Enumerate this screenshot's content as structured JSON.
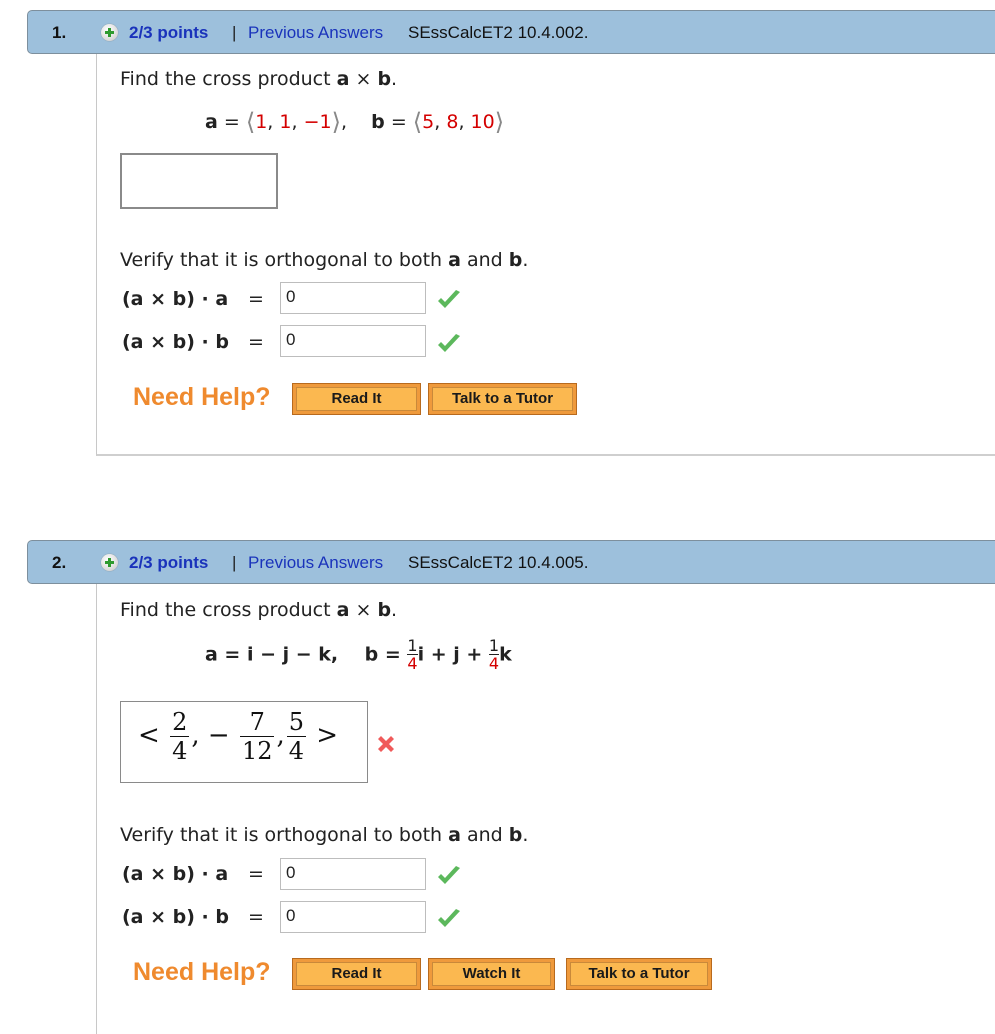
{
  "questions": [
    {
      "number": "1.",
      "points": "2/3 points",
      "separator": "|",
      "previous_answers": "Previous Answers",
      "code": "SEssCalcET2 10.4.002.",
      "prompt": {
        "prefix": "Find the cross product ",
        "a": "a",
        "times": " × ",
        "b": "b",
        "end": "."
      },
      "given": {
        "a_label": "a",
        "eq": " = ",
        "b_label": "b",
        "a_components": [
          "1",
          "1",
          "−1"
        ],
        "b_components": [
          "5",
          "8",
          "10"
        ]
      },
      "answer": {
        "value": "",
        "status": "empty"
      },
      "verify": {
        "prefix": "Verify that it is orthogonal to both ",
        "a": "a",
        "and": " and ",
        "b": "b",
        "end": "."
      },
      "dot_rows": [
        {
          "label_a": "(a × b) · ",
          "label_v": "a",
          "eq": "=",
          "value": "0",
          "status": "correct"
        },
        {
          "label_a": "(a × b) · ",
          "label_v": "b",
          "eq": "=",
          "value": "0",
          "status": "correct"
        }
      ],
      "help": {
        "label": "Need Help?",
        "buttons": [
          "Read It",
          "Talk to a Tutor"
        ]
      }
    },
    {
      "number": "2.",
      "points": "2/3 points",
      "separator": "|",
      "previous_answers": "Previous Answers",
      "code": "SEssCalcET2 10.4.005.",
      "prompt": {
        "prefix": "Find the cross product ",
        "a": "a",
        "times": " × ",
        "b": "b",
        "end": "."
      },
      "given": {
        "a_expr": "a = i − j − k,",
        "b_label": "b = ",
        "b_i_num": "1",
        "b_i_den": "4",
        "b_mid": "i + j + ",
        "b_k_num": "1",
        "b_k_den": "4",
        "b_end": "k"
      },
      "answer": {
        "open": "<",
        "close": ">",
        "minus": "−",
        "fractions": [
          {
            "num": "2",
            "den": "4"
          },
          {
            "num": "7",
            "den": "12"
          },
          {
            "num": "5",
            "den": "4"
          }
        ],
        "status": "incorrect"
      },
      "verify": {
        "prefix": "Verify that it is orthogonal to both ",
        "a": "a",
        "and": " and ",
        "b": "b",
        "end": "."
      },
      "dot_rows": [
        {
          "label_a": "(a × b) · ",
          "label_v": "a",
          "eq": "=",
          "value": "0",
          "status": "correct"
        },
        {
          "label_a": "(a × b) · ",
          "label_v": "b",
          "eq": "=",
          "value": "0",
          "status": "correct"
        }
      ],
      "help": {
        "label": "Need Help?",
        "buttons": [
          "Read It",
          "Watch It",
          "Talk to a Tutor"
        ]
      }
    }
  ],
  "colors": {
    "header_bg": "#9dc0dc",
    "link": "#1a33bb",
    "help_orange": "#ef8a2e",
    "button_fill": "#fbb850",
    "value_red": "#d40000",
    "check_green": "#5cb85c",
    "x_red": "#f05a5a"
  }
}
